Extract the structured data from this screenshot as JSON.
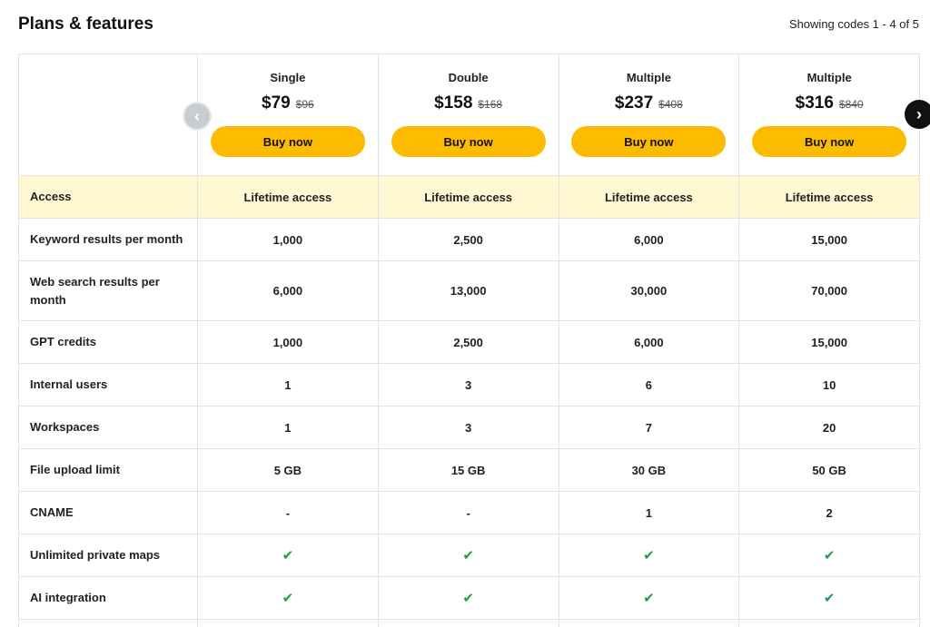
{
  "header": {
    "title": "Plans & features",
    "showing": "Showing codes 1 - 4 of 5"
  },
  "nav": {
    "prev_icon": "chevron-left-icon",
    "next_icon": "chevron-right-icon"
  },
  "plans": [
    {
      "name": "Single",
      "price": "$79",
      "old_price": "$96",
      "buy_label": "Buy now"
    },
    {
      "name": "Double",
      "price": "$158",
      "old_price": "$168",
      "buy_label": "Buy now"
    },
    {
      "name": "Multiple",
      "price": "$237",
      "old_price": "$408",
      "buy_label": "Buy now"
    },
    {
      "name": "Multiple",
      "price": "$316",
      "old_price": "$840",
      "buy_label": "Buy now"
    }
  ],
  "features": [
    {
      "label": "Access",
      "values": [
        "Lifetime access",
        "Lifetime access",
        "Lifetime access",
        "Lifetime access"
      ]
    },
    {
      "label": "Keyword results per month",
      "values": [
        "1,000",
        "2,500",
        "6,000",
        "15,000"
      ]
    },
    {
      "label": "Web search results per month",
      "values": [
        "6,000",
        "13,000",
        "30,000",
        "70,000"
      ]
    },
    {
      "label": "GPT credits",
      "values": [
        "1,000",
        "2,500",
        "6,000",
        "15,000"
      ]
    },
    {
      "label": "Internal users",
      "values": [
        "1",
        "3",
        "6",
        "10"
      ]
    },
    {
      "label": "Workspaces",
      "values": [
        "1",
        "3",
        "7",
        "20"
      ]
    },
    {
      "label": "File upload limit",
      "values": [
        "5 GB",
        "15 GB",
        "30 GB",
        "50 GB"
      ]
    },
    {
      "label": "CNAME",
      "values": [
        "-",
        "-",
        "1",
        "2"
      ]
    },
    {
      "label": "Unlimited private maps",
      "values": [
        "✔",
        "✔",
        "✔",
        "✔"
      ]
    },
    {
      "label": "AI integration",
      "values": [
        "✔",
        "✔",
        "✔",
        "✔"
      ]
    }
  ],
  "colors": {
    "accent": "#fdbb00",
    "highlight_row": "#fff8d2",
    "check": "#1e9e47"
  }
}
